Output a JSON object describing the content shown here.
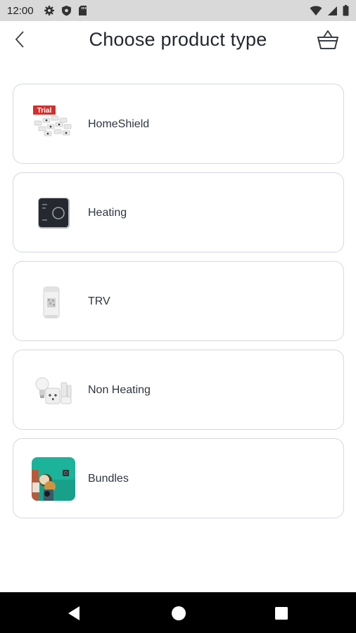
{
  "status_bar": {
    "time": "12:00",
    "icons": [
      "gear-icon",
      "shield-icon",
      "sd-card-icon"
    ],
    "right_icons": [
      "wifi-icon",
      "signal-icon",
      "battery-icon"
    ]
  },
  "header": {
    "title": "Choose product type",
    "back_icon": "chevron-left-icon",
    "basket_icon": "basket-icon"
  },
  "products": [
    {
      "label": "HomeShield",
      "badge": "Trial",
      "image": "homeshield-devices"
    },
    {
      "label": "Heating",
      "image": "thermostat"
    },
    {
      "label": "TRV",
      "image": "radiator-valve"
    },
    {
      "label": "Non Heating",
      "image": "bulb-plug-sensors"
    },
    {
      "label": "Bundles",
      "image": "bundle-photo"
    }
  ],
  "colors": {
    "card_border": "#d4d8de",
    "text": "#2f3640",
    "trial_badge": "#d32f2f",
    "bundle_bg": "#1bb39a"
  }
}
